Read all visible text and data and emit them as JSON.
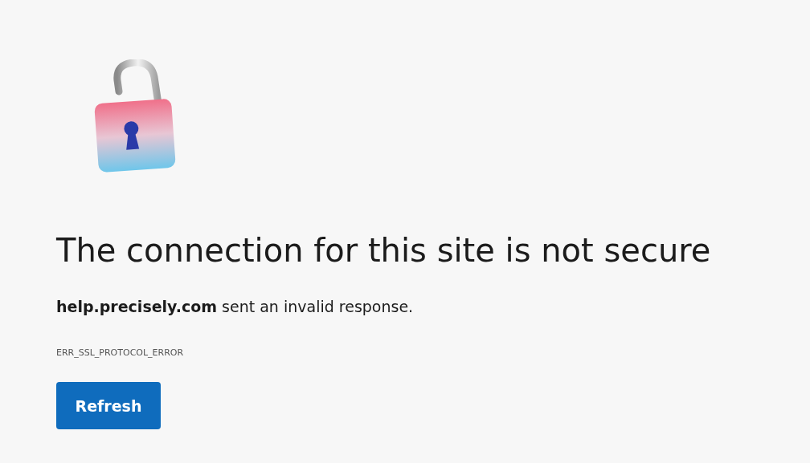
{
  "heading": "The connection for this site is not secure",
  "message": "**help.precisely.com** sent an invalid response.",
  "error_code": "ERR_SSL_PROTOCOL_ERROR",
  "buttons": [
    "Refresh"
  ]
}
